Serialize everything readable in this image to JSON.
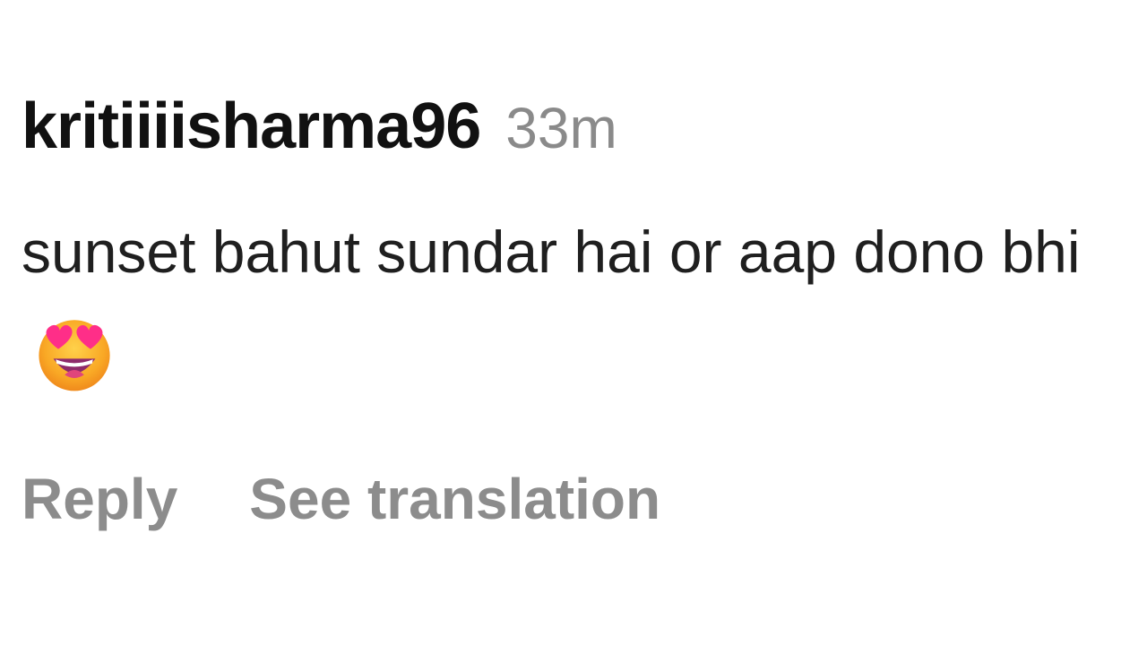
{
  "comment": {
    "username": "kritiiiisharma96",
    "timestamp": "33m",
    "text": "sunset bahut sundar hai or aap dono bhi",
    "emoji": "heart-eyes-smiling-face",
    "actions": {
      "reply_label": "Reply",
      "translate_label": "See translation"
    },
    "colors": {
      "username": "#111111",
      "timestamp": "#8a8a8a",
      "text": "#1f1f1f",
      "action": "#8c8c8c"
    }
  }
}
